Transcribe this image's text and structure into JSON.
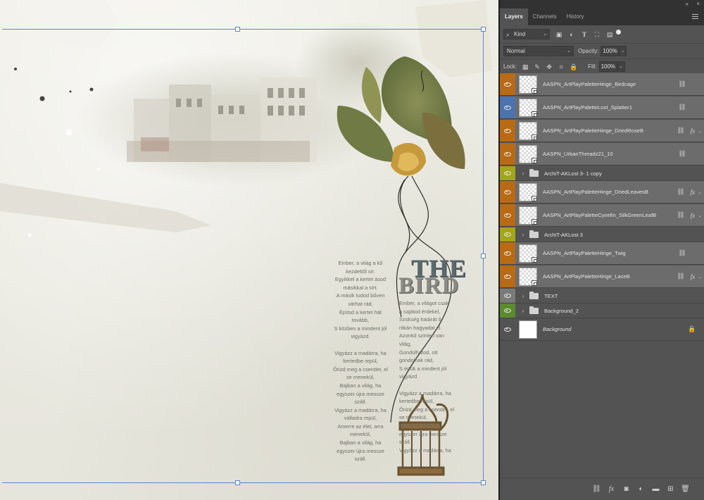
{
  "canvas": {
    "title_the": "THE",
    "title_bird": "BIRD",
    "text_left": "Ember, a világ a kő\nkezdettől sír.\nEgyikkel a kertet ásod\nmásikkal a sírt.\nA másik tudod bőven\nvárhat rád,\nÉpítsd a kertet hát\ntovább,\nS közben a mindent jól\nvigyázd.\n\nVigyázz a madárra, ha\nkertedbe repül,\nŐrizd meg a csendet, el\nse menekül,\nBajban a világ, ha\negyszer újra messze\nszáll.\nVigyázz a madárra, ha\nválladra repül,\nAmerre az élet, arra\nmenekül,\nBajban a világ, ha\negyszer újra messze\nszáll.",
    "text_right": "Ember, a világot csak\na sajátod érdekel,\nSzükség határát ő\nritkán hagyadat el.\nAzontúl szinten van\nvilág,\nGondolhatod, ott\ngondolnak rád,\nS értük a mindent jól\nvigyázd.\n\nVigyázz a madárra, ha\nkertedbe repül,\nŐrizd meg a csendet, el\nse menekül,\nBajban a világ, ha\negyszer újra messze\nszáll.\nVigyázz a madárra, ha"
  },
  "panel": {
    "collapse_glyph": "«",
    "close_glyph": "×",
    "tabs": [
      "Layers",
      "Channels",
      "History"
    ],
    "filter": {
      "kind_label": "Kind"
    },
    "blend": {
      "mode": "Normal",
      "opacity_label": "Opacity:",
      "opacity_value": "100%"
    },
    "lock": {
      "label": "Lock:",
      "fill_label": "Fill:",
      "fill_value": "100%"
    },
    "layers": [
      {
        "name": "AASPN_ArtPlayPaletteHinge_Birdcage",
        "color": "#b86a14",
        "kind": "smart",
        "link": true,
        "fx": false
      },
      {
        "name": "AASPN_ArtPlayPaletteLost_Splatter1",
        "color": "#4d72b0",
        "kind": "smart",
        "link": true,
        "fx": false
      },
      {
        "name": "AASPN_ArtPlayPaletteHinge_DriedRoseB",
        "color": "#b86a14",
        "kind": "smart",
        "link": true,
        "fx": true
      },
      {
        "name": "AASPN_UrbanThreadz21_10",
        "color": "#b86a14",
        "kind": "smart",
        "link": true,
        "fx": false
      },
      {
        "name": "ArchiT-AKLost 3- 1 copy",
        "color": "#a3a51a",
        "kind": "group",
        "link": false,
        "fx": false
      },
      {
        "name": "AASPN_ArtPlayPaletteHinge_DriedLeavesB",
        "color": "#b86a14",
        "kind": "smart",
        "link": true,
        "fx": true
      },
      {
        "name": "AASPN_ArtPlayPaletteCynefin_SilkGreenLeafB",
        "color": "#b86a14",
        "kind": "smart",
        "link": true,
        "fx": true
      },
      {
        "name": "ArchiT-AKLost 3",
        "color": "#a3a51a",
        "kind": "group",
        "link": false,
        "fx": false
      },
      {
        "name": "AASPN_ArtPlayPaletteHinge_Twig",
        "color": "#b86a14",
        "kind": "smart",
        "link": true,
        "fx": false
      },
      {
        "name": "AASPN_ArtPlayPaletteHinge_LaceB",
        "color": "#b86a14",
        "kind": "smart",
        "link": true,
        "fx": true
      },
      {
        "name": "TEXT",
        "color": "#7a7a7a",
        "kind": "group",
        "link": false,
        "fx": false
      },
      {
        "name": "Background_2",
        "color": "#5c8a2e",
        "kind": "group",
        "link": false,
        "fx": false
      },
      {
        "name": "Background",
        "color": "",
        "kind": "background",
        "link": false,
        "fx": false,
        "locked": true
      }
    ],
    "bottom_icons": [
      "link-layers-icon",
      "fx-icon",
      "add-mask-icon",
      "adjustment-layer-icon",
      "new-group-icon",
      "new-layer-icon",
      "trash-icon"
    ]
  }
}
